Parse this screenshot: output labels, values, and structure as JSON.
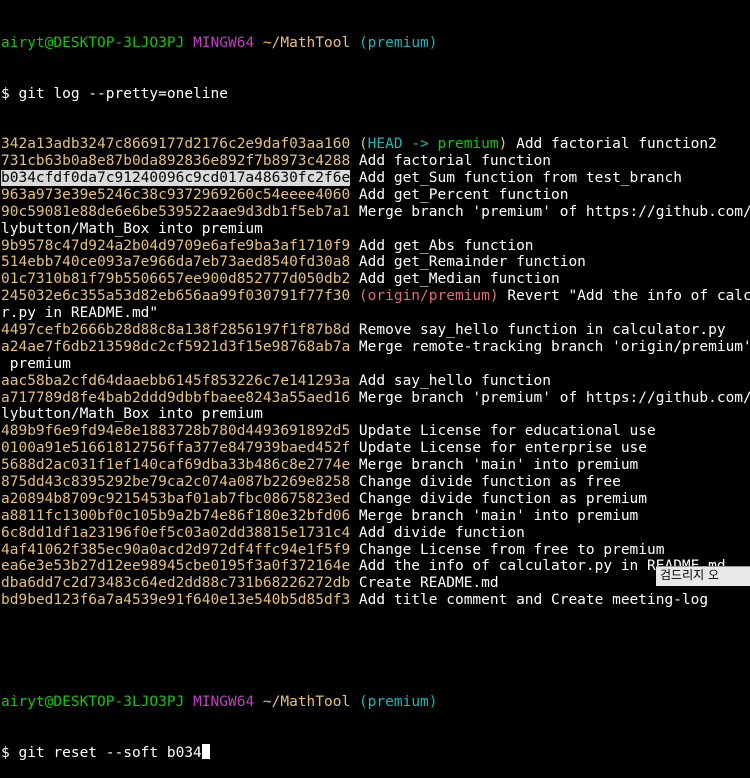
{
  "colors": {
    "hash": "#e5c07b",
    "prompt_user": "#16c60c",
    "prompt_app": "#bf40bf",
    "prompt_path": "#e5c07b",
    "branch": "#1fb5b5",
    "origin": "#e06c75",
    "highlight": "#dadada"
  },
  "prompt1": {
    "user": "airyt@DESKTOP-3LJO3PJ",
    "app": "MINGW64",
    "path": "~/MathTool",
    "branch": "(premium)",
    "command": "$ git log --pretty=oneline"
  },
  "log": [
    {
      "hash": "342a13adb3247c8669177d2176c2e9daf03aa160",
      "ref_open": "(",
      "head": "HEAD -> ",
      "branch": "premium",
      "ref_close": ")",
      "msg": " Add factorial function2"
    },
    {
      "hash": "731cb63b0a8e87b0da892836e892f7b8973c4288",
      "msg": " Add factorial function"
    },
    {
      "hash": "b034cfdf0da7c91240096c9cd017a48630fc2f6e",
      "msg": " Add get_Sum function from test_branch",
      "selected": true
    },
    {
      "hash": "963a973e39e5246c38c9372969260c54eeee4060",
      "msg": " Add get_Percent function"
    },
    {
      "hash": "90c59081e88de6e6be539522aae9d3db1f5eb7a1",
      "msg": " Merge branch 'premium' of https://github.com/ai",
      "cont": "lybutton/Math_Box into premium"
    },
    {
      "hash": "9b9578c47d924a2b04d9709e6afe9ba3af1710f9",
      "msg": " Add get_Abs function"
    },
    {
      "hash": "514ebb740ce093a7e966da7eb73aed8540fd30a8",
      "msg": " Add get_Remainder function"
    },
    {
      "hash": "01c7310b81f79b5506657ee900d852777d050db2",
      "msg": " Add get_Median function"
    },
    {
      "hash": "245032e6c355a53d82eb656aa99f030791f77f30",
      "origin": " (origin/premium)",
      "msg": " Revert \"Add the info of calculato",
      "cont": "r.py in README.md\""
    },
    {
      "hash": "4497cefb2666b28d88c8a138f2856197f1f87b8d",
      "msg": " Remove say_hello function in calculator.py"
    },
    {
      "hash": "a24ae7f6db213598dc2cf5921d3f15e98768ab7a",
      "msg": " Merge remote-tracking branch 'origin/premium' into",
      "cont": " premium"
    },
    {
      "hash": "aac58ba2cfd64daaebb6145f853226c7e141293a",
      "msg": " Add say_hello function"
    },
    {
      "hash": "a717789d8fe4bab2ddd9dbbfbaee8243a55aed16",
      "msg": " Merge branch 'premium' of https://github.com/ai",
      "cont": "lybutton/Math_Box into premium"
    },
    {
      "hash": "489b9f6e9fd94e8e1883728b780d4493691892d5",
      "msg": " Update License for educational use"
    },
    {
      "hash": "0100a91e51661812756ffa377e847939baed452f",
      "msg": " Update License for enterprise use"
    },
    {
      "hash": "5688d2ac031f1ef140caf69dba33b486c8e2774e",
      "msg": " Merge branch 'main' into premium"
    },
    {
      "hash": "875dd43c8395292be79ca2c074a087b2269e8258",
      "msg": " Change divide function as free"
    },
    {
      "hash": "a20894b8709c9215453baf01ab7fbc08675823ed",
      "msg": " Change divide function as premium"
    },
    {
      "hash": "a8811fc1300bf0c105b9a2b74e86f180e32bfd06",
      "msg": " Merge branch 'main' into premium"
    },
    {
      "hash": "6c8dd1df1a23196f0ef5c03a02dd38815e1731c4",
      "msg": " Add divide function"
    },
    {
      "hash": "4af41062f385ec90a0acd2d972df4ffc94e1f5f9",
      "msg": " Change License from free to premium"
    },
    {
      "hash": "ea6e3e53b27d12ee98945cbe0195f3a0f372164e",
      "msg": " Add the info of calculator.py in README.md"
    },
    {
      "hash": "dba6dd7c2d73483c64ed2dd88c731b68226272db",
      "msg": " Create README.md"
    },
    {
      "hash": "bd9bed123f6a7a4539e91f640e13e540b5d85df3",
      "msg": " Add title comment and Create meeting-log"
    }
  ],
  "prompt2": {
    "user": "airyt@DESKTOP-3LJO3PJ",
    "app": "MINGW64",
    "path": "~/MathTool",
    "branch": "(premium)",
    "command": "$ git reset --soft b034"
  },
  "ime_text": "검드리지 오"
}
